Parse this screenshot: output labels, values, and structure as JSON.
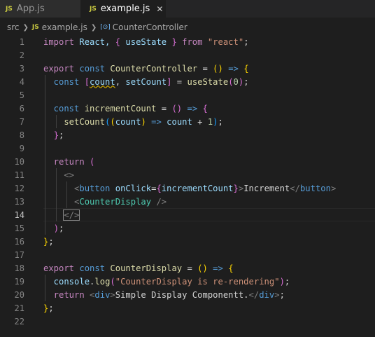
{
  "tabs": [
    {
      "icon": "JS",
      "label": "App.js"
    },
    {
      "icon": "JS",
      "label": "example.js",
      "close": "✕"
    }
  ],
  "breadcrumb": {
    "folder": "src",
    "file_icon": "JS",
    "file": "example.js",
    "symbol_icon": "[⊙]",
    "symbol": "CounterController"
  },
  "editor": {
    "active_line": 14,
    "lines": [
      {
        "n": "1",
        "tokens": [
          [
            "import",
            "t-ctl"
          ],
          [
            " React, ",
            "t-var"
          ],
          [
            "{",
            "t-br2"
          ],
          [
            " useState ",
            "t-var"
          ],
          [
            "}",
            "t-br2"
          ],
          [
            " from ",
            "t-ctl"
          ],
          [
            "\"react\"",
            "t-str"
          ],
          [
            ";",
            "t-pl"
          ]
        ]
      },
      {
        "n": "2",
        "tokens": []
      },
      {
        "n": "3",
        "tokens": [
          [
            "export",
            "t-ctl"
          ],
          [
            " const ",
            "t-kw"
          ],
          [
            "CounterController",
            "t-fn"
          ],
          [
            " = ",
            "t-pl"
          ],
          [
            "()",
            "t-br1"
          ],
          [
            " => ",
            "t-kw"
          ],
          [
            "{",
            "t-br1"
          ]
        ]
      },
      {
        "n": "4",
        "tokens": [
          [
            "  const ",
            "t-kw"
          ],
          [
            "[",
            "t-br2"
          ],
          [
            "count",
            "t-var squig"
          ],
          [
            ", ",
            "t-pl"
          ],
          [
            "setCount",
            "t-var"
          ],
          [
            "]",
            "t-br2"
          ],
          [
            " = ",
            "t-pl"
          ],
          [
            "useState",
            "t-fn"
          ],
          [
            "(",
            "t-br2"
          ],
          [
            "0",
            "t-num"
          ],
          [
            ")",
            "t-br2"
          ],
          [
            ";",
            "t-pl"
          ]
        ]
      },
      {
        "n": "5",
        "tokens": []
      },
      {
        "n": "6",
        "tokens": [
          [
            "  const ",
            "t-kw"
          ],
          [
            "incrementCount",
            "t-fn"
          ],
          [
            " = ",
            "t-pl"
          ],
          [
            "()",
            "t-br2"
          ],
          [
            " => ",
            "t-kw"
          ],
          [
            "{",
            "t-br2"
          ]
        ]
      },
      {
        "n": "7",
        "tokens": [
          [
            "    setCount",
            "t-fn"
          ],
          [
            "(",
            "t-br3"
          ],
          [
            "(",
            "t-br1"
          ],
          [
            "count",
            "t-var"
          ],
          [
            ")",
            "t-br1"
          ],
          [
            " => ",
            "t-kw"
          ],
          [
            "count",
            "t-var"
          ],
          [
            " + ",
            "t-pl"
          ],
          [
            "1",
            "t-num"
          ],
          [
            ")",
            "t-br3"
          ],
          [
            ";",
            "t-pl"
          ]
        ]
      },
      {
        "n": "8",
        "tokens": [
          [
            "  ",
            "t-pl"
          ],
          [
            "}",
            "t-br2"
          ],
          [
            ";",
            "t-pl"
          ]
        ]
      },
      {
        "n": "9",
        "tokens": []
      },
      {
        "n": "10",
        "tokens": [
          [
            "  return ",
            "t-ctl"
          ],
          [
            "(",
            "t-br2"
          ]
        ]
      },
      {
        "n": "11",
        "tokens": [
          [
            "    <>",
            "t-tag"
          ]
        ]
      },
      {
        "n": "12",
        "tokens": [
          [
            "      <",
            "t-tag"
          ],
          [
            "button",
            "t-htm"
          ],
          [
            " onClick",
            "t-var"
          ],
          [
            "=",
            "t-pl"
          ],
          [
            "{",
            "t-br2"
          ],
          [
            "incrementCount",
            "t-var"
          ],
          [
            "}",
            "t-br2"
          ],
          [
            ">",
            "t-tag"
          ],
          [
            "Increment",
            "t-pl"
          ],
          [
            "</",
            "t-tag"
          ],
          [
            "button",
            "t-htm"
          ],
          [
            ">",
            "t-tag"
          ]
        ]
      },
      {
        "n": "13",
        "tokens": [
          [
            "      <",
            "t-tag"
          ],
          [
            "CounterDisplay",
            "t-comp"
          ],
          [
            " />",
            "t-tag"
          ]
        ]
      },
      {
        "n": "14",
        "tokens": [
          [
            "    ",
            "t-pl"
          ],
          [
            "</>",
            "t-tag hl"
          ]
        ]
      },
      {
        "n": "15",
        "tokens": [
          [
            "  ",
            "t-pl"
          ],
          [
            ")",
            "t-br2"
          ],
          [
            ";",
            "t-pl"
          ]
        ]
      },
      {
        "n": "16",
        "tokens": [
          [
            "}",
            "t-br1"
          ],
          [
            ";",
            "t-pl"
          ]
        ]
      },
      {
        "n": "17",
        "tokens": []
      },
      {
        "n": "18",
        "tokens": [
          [
            "export",
            "t-ctl"
          ],
          [
            " const ",
            "t-kw"
          ],
          [
            "CounterDisplay",
            "t-fn"
          ],
          [
            " = ",
            "t-pl"
          ],
          [
            "()",
            "t-br1"
          ],
          [
            " => ",
            "t-kw"
          ],
          [
            "{",
            "t-br1"
          ]
        ]
      },
      {
        "n": "19",
        "tokens": [
          [
            "  console",
            "t-var"
          ],
          [
            ".",
            "t-pl"
          ],
          [
            "log",
            "t-fn"
          ],
          [
            "(",
            "t-br2"
          ],
          [
            "\"CounterDisplay is re-rendering\"",
            "t-str"
          ],
          [
            ")",
            "t-br2"
          ],
          [
            ";",
            "t-pl"
          ]
        ]
      },
      {
        "n": "20",
        "tokens": [
          [
            "  return ",
            "t-ctl"
          ],
          [
            "<",
            "t-tag"
          ],
          [
            "div",
            "t-htm"
          ],
          [
            ">",
            "t-tag"
          ],
          [
            "Simple Display Componentt.",
            "t-pl"
          ],
          [
            "</",
            "t-tag"
          ],
          [
            "div",
            "t-htm"
          ],
          [
            ">",
            "t-tag"
          ],
          [
            ";",
            "t-pl"
          ]
        ]
      },
      {
        "n": "21",
        "tokens": [
          [
            "}",
            "t-br1"
          ],
          [
            ";",
            "t-pl"
          ]
        ]
      },
      {
        "n": "22",
        "tokens": []
      }
    ]
  }
}
